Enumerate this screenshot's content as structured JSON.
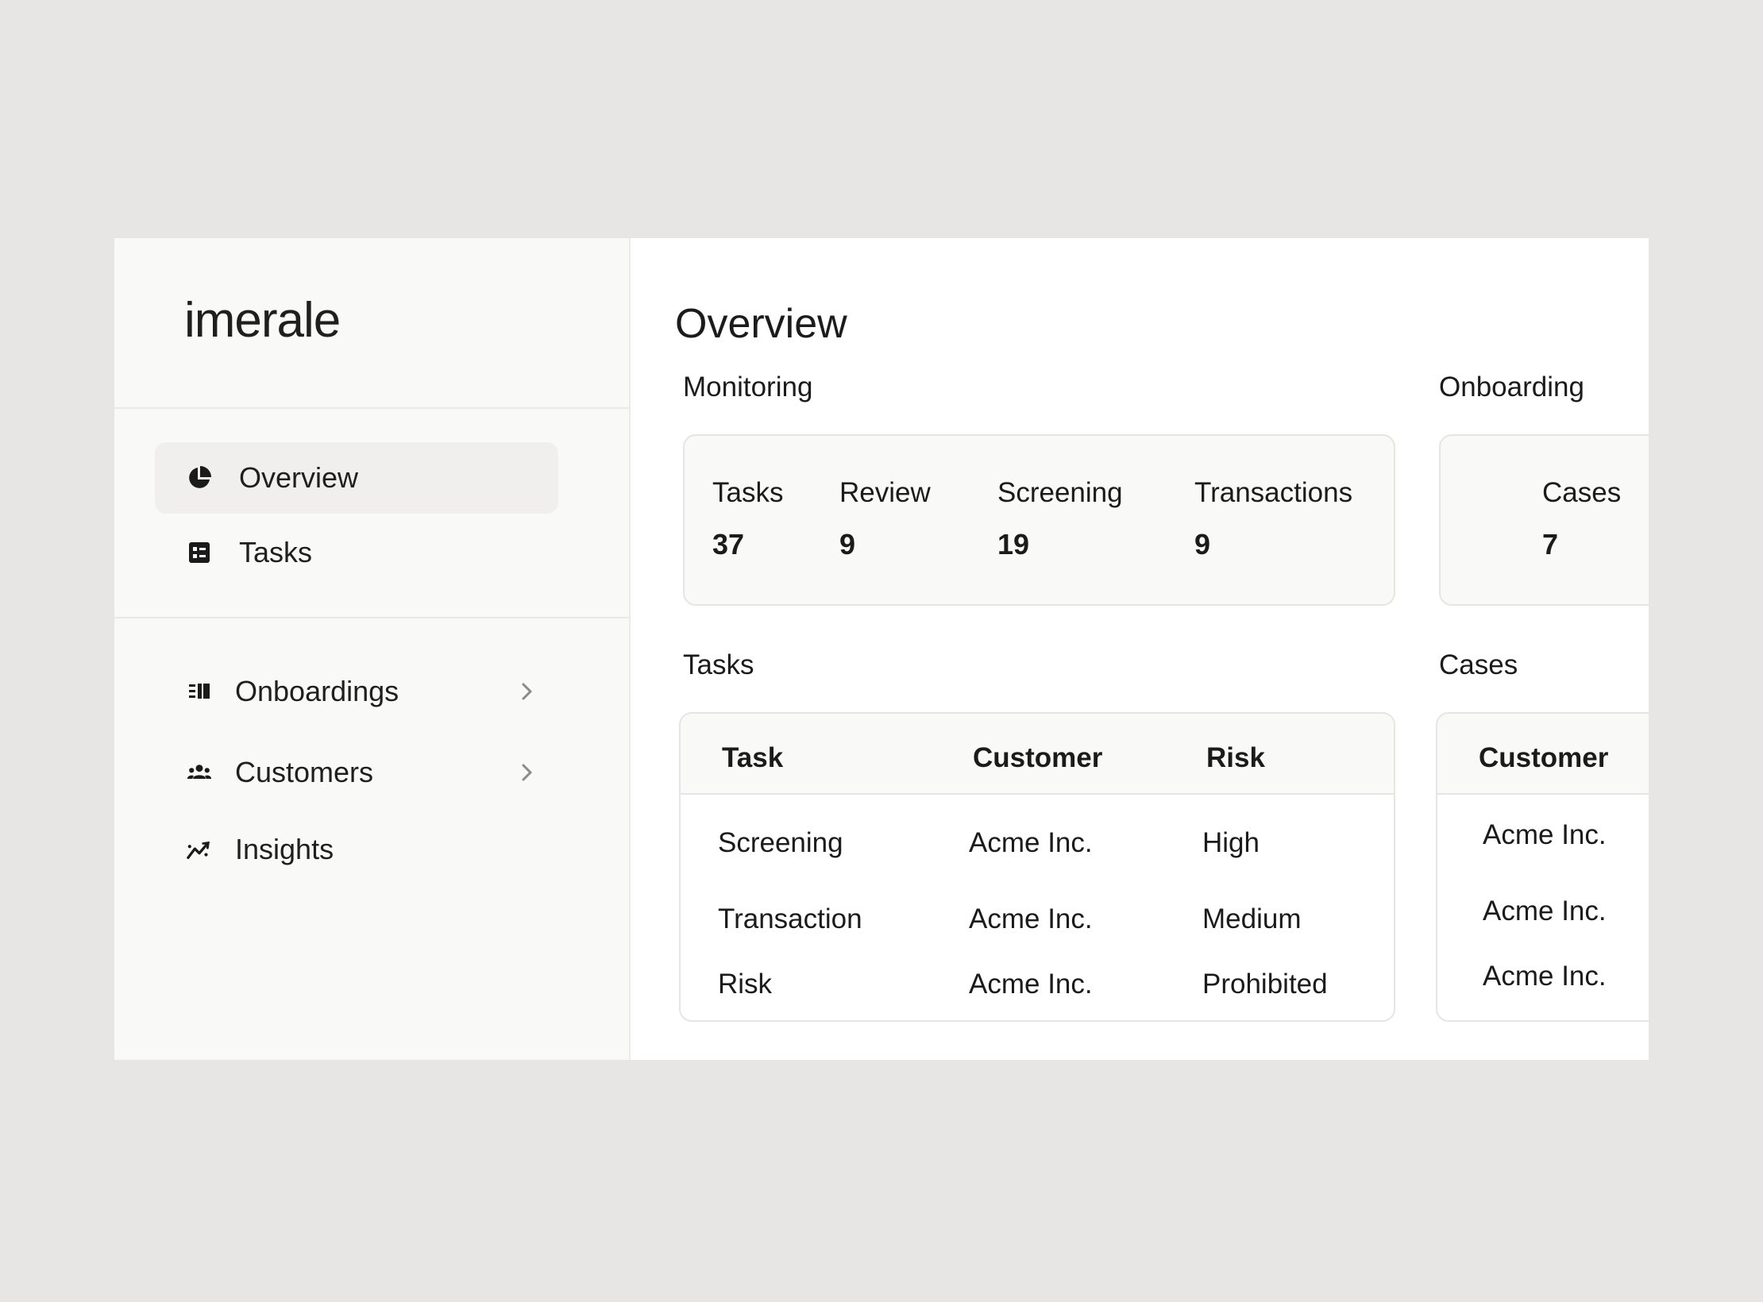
{
  "app": {
    "logo": "imerale"
  },
  "sidebar": {
    "primary": [
      {
        "label": "Overview",
        "icon": "pie-chart-icon",
        "active": true
      },
      {
        "label": "Tasks",
        "icon": "task-list-icon",
        "active": false
      }
    ],
    "secondary": [
      {
        "label": "Onboardings",
        "icon": "onboarding-list-icon",
        "has_chevron": true
      },
      {
        "label": "Customers",
        "icon": "users-icon",
        "has_chevron": true
      },
      {
        "label": "Insights",
        "icon": "trend-line-icon",
        "has_chevron": false
      }
    ]
  },
  "main": {
    "title": "Overview",
    "monitoring": {
      "label": "Monitoring",
      "stats": [
        {
          "label": "Tasks",
          "value": "37"
        },
        {
          "label": "Review",
          "value": "9"
        },
        {
          "label": "Screening",
          "value": "19"
        },
        {
          "label": "Transactions",
          "value": "9"
        }
      ]
    },
    "onboarding": {
      "label": "Onboarding",
      "stats": [
        {
          "label": "Cases",
          "value": "7"
        }
      ]
    },
    "tasks_table": {
      "label": "Tasks",
      "headers": [
        "Task",
        "Customer",
        "Risk"
      ],
      "rows": [
        [
          "Screening",
          "Acme Inc.",
          "High"
        ],
        [
          "Transaction",
          "Acme Inc.",
          "Medium"
        ],
        [
          "Risk",
          "Acme Inc.",
          "Prohibited"
        ]
      ]
    },
    "cases_table": {
      "label": "Cases",
      "headers": [
        "Customer"
      ],
      "rows": [
        [
          "Acme Inc."
        ],
        [
          "Acme Inc."
        ],
        [
          "Acme Inc."
        ]
      ]
    }
  },
  "colors": {
    "background": "#e7e6e4",
    "sidebar": "#f9f9f8",
    "active_item": "#f0efed",
    "border": "#e6e5e3",
    "text": "#1b1b1b"
  }
}
